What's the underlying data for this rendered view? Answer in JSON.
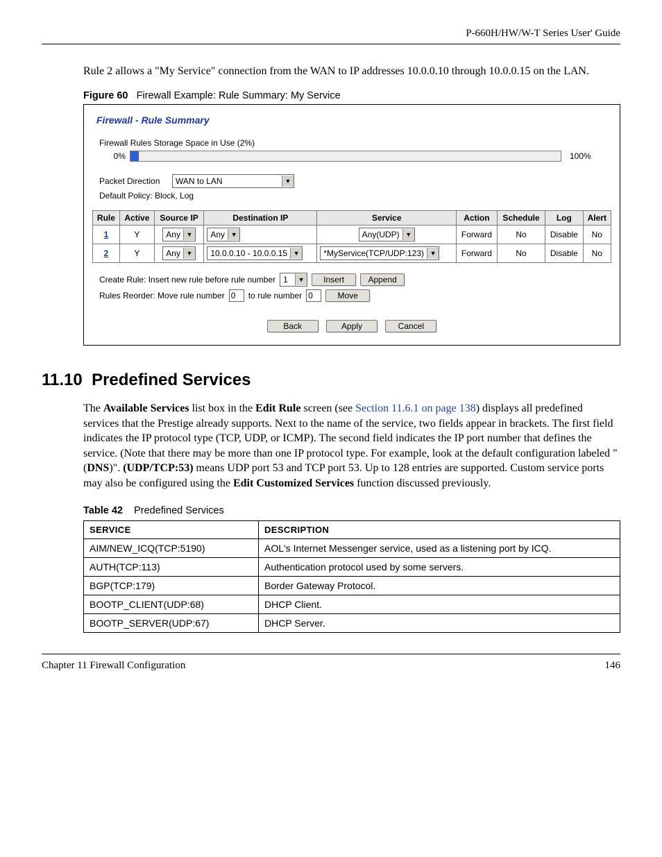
{
  "header": {
    "guide": "P-660H/HW/W-T Series User' Guide"
  },
  "intro": "Rule 2 allows a \"My Service\" connection from the WAN to IP addresses 10.0.0.10 through 10.0.0.15 on the LAN.",
  "figure": {
    "label": "Figure 60",
    "title": "Firewall Example: Rule Summary: My Service"
  },
  "screenshot": {
    "title": "Firewall - Rule Summary",
    "storage_label": "Firewall Rules Storage Space in Use  (2%)",
    "pct0": "0%",
    "pct100": "100%",
    "packet_direction_label": "Packet Direction",
    "packet_direction_value": "WAN to LAN",
    "default_policy": "Default Policy: Block, Log",
    "headers": {
      "rule": "Rule",
      "active": "Active",
      "srcip": "Source IP",
      "dstip": "Destination IP",
      "service": "Service",
      "action": "Action",
      "schedule": "Schedule",
      "log": "Log",
      "alert": "Alert"
    },
    "rows": [
      {
        "rule": "1",
        "active": "Y",
        "src": "Any",
        "dst": "Any",
        "service": "Any(UDP)",
        "action": "Forward",
        "schedule": "No",
        "log": "Disable",
        "alert": "No"
      },
      {
        "rule": "2",
        "active": "Y",
        "src": "Any",
        "dst": "10.0.0.10 - 10.0.0.15",
        "service": "*MyService(TCP/UDP:123)",
        "action": "Forward",
        "schedule": "No",
        "log": "Disable",
        "alert": "No"
      }
    ],
    "create_label": "Create Rule: Insert new rule before rule number",
    "create_value": "1",
    "insert_btn": "Insert",
    "append_btn": "Append",
    "reorder_label_a": "Rules Reorder: Move rule number",
    "reorder_val_a": "0",
    "reorder_label_b": "to rule number",
    "reorder_val_b": "0",
    "move_btn": "Move",
    "back_btn": "Back",
    "apply_btn": "Apply",
    "cancel_btn": "Cancel"
  },
  "section": {
    "number": "11.10",
    "title": "Predefined Services"
  },
  "para": {
    "p1a": "The ",
    "p1b": "Available Services",
    "p1c": " list box in the ",
    "p1d": "Edit Rule",
    "p1e": " screen (see ",
    "p1link": "Section 11.6.1 on page 138",
    "p1f": ") displays all predefined services that the Prestige already supports. Next to the name of the service, two fields appear in brackets. The first field indicates the IP protocol type (TCP, UDP, or ICMP). The second field indicates the IP port number that defines the service. (Note that there may be more than one IP protocol type. For example, look at the default configuration labeled \"(",
    "p1g": "DNS",
    "p1h": ")\". ",
    "p1i": "(UDP/TCP:53)",
    "p1j": " means UDP port 53 and TCP port 53. Up to 128 entries are supported. Custom service ports may also be configured using the ",
    "p1k": "Edit Customized Services",
    "p1l": " function discussed previously."
  },
  "table": {
    "label": "Table 42",
    "title": "Predefined Services",
    "h1": "SERVICE",
    "h2": "DESCRIPTION",
    "rows": [
      {
        "s": "AIM/NEW_ICQ(TCP:5190)",
        "d": "AOL's Internet Messenger service, used as a listening port by ICQ."
      },
      {
        "s": "AUTH(TCP:113)",
        "d": "Authentication protocol used by some servers."
      },
      {
        "s": "BGP(TCP:179)",
        "d": "Border Gateway Protocol."
      },
      {
        "s": "BOOTP_CLIENT(UDP:68)",
        "d": "DHCP Client."
      },
      {
        "s": "BOOTP_SERVER(UDP:67)",
        "d": "DHCP Server."
      }
    ]
  },
  "footer": {
    "left": "Chapter 11 Firewall Configuration",
    "right": "146"
  }
}
